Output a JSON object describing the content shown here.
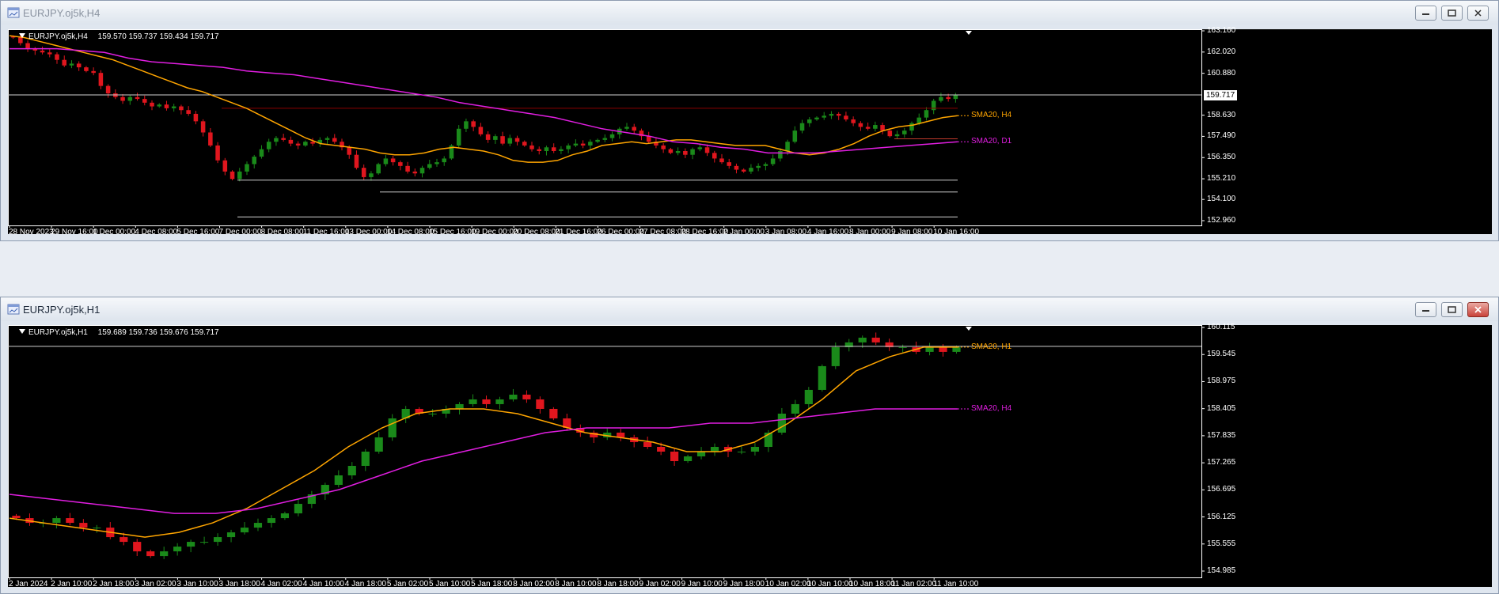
{
  "colors": {
    "bull": "#1a8a1a",
    "bear": "#e0161e",
    "sma_h4": "#ffa500",
    "sma_d1": "#e11ee1",
    "grid": "#ffffff"
  },
  "window1": {
    "title": "EURJPY.oj5k,H4",
    "symbol_tf": "EURJPY.oj5k,H4",
    "open": "159.570",
    "high": "159.737",
    "low": "159.434",
    "close": "159.717",
    "current_price": "159.717",
    "price_labels": [
      "163.160",
      "162.020",
      "160.880",
      "159.717",
      "158.630",
      "157.490",
      "156.350",
      "155.210",
      "154.100",
      "152.960"
    ],
    "time_labels": [
      "28 Nov 2023",
      "29 Nov 16:00",
      "1 Dec 00:00",
      "4 Dec 08:00",
      "5 Dec 16:00",
      "7 Dec 00:00",
      "8 Dec 08:00",
      "11 Dec 16:00",
      "13 Dec 00:00",
      "14 Dec 08:00",
      "15 Dec 16:00",
      "19 Dec 00:00",
      "20 Dec 08:00",
      "21 Dec 16:00",
      "26 Dec 00:00",
      "27 Dec 08:00",
      "28 Dec 16:00",
      "2 Jan 00:00",
      "3 Jan 08:00",
      "4 Jan 16:00",
      "8 Jan 00:00",
      "9 Jan 08:00",
      "10 Jan 16:00"
    ],
    "indicators": [
      {
        "label": "SMA20, H4",
        "color": "#ffa500"
      },
      {
        "label": "SMA20, D1",
        "color": "#e11ee1"
      }
    ]
  },
  "window2": {
    "title": "EURJPY.oj5k,H1",
    "symbol_tf": "EURJPY.oj5k,H1",
    "open": "159.689",
    "high": "159.736",
    "low": "159.676",
    "close": "159.717",
    "current_price": "159.717",
    "price_labels": [
      "160.115",
      "159.545",
      "158.975",
      "158.405",
      "157.835",
      "157.265",
      "156.695",
      "156.125",
      "155.555",
      "154.985"
    ],
    "time_labels": [
      "2 Jan 2024",
      "2 Jan 10:00",
      "2 Jan 18:00",
      "3 Jan 02:00",
      "3 Jan 10:00",
      "3 Jan 18:00",
      "4 Jan 02:00",
      "4 Jan 10:00",
      "4 Jan 18:00",
      "5 Jan 02:00",
      "5 Jan 10:00",
      "5 Jan 18:00",
      "8 Jan 02:00",
      "8 Jan 10:00",
      "8 Jan 18:00",
      "9 Jan 02:00",
      "9 Jan 10:00",
      "9 Jan 18:00",
      "10 Jan 02:00",
      "10 Jan 10:00",
      "10 Jan 18:00",
      "11 Jan 02:00",
      "11 Jan 10:00"
    ],
    "indicators": [
      {
        "label": "SMA20, H1",
        "color": "#ffa500"
      },
      {
        "label": "SMA20, H4",
        "color": "#e11ee1"
      }
    ]
  },
  "chart_data": [
    {
      "type": "candlestick",
      "title": "EURJPY.oj5k,H4",
      "ylim": [
        152.96,
        163.16
      ],
      "y_ticks": [
        163.16,
        162.02,
        160.88,
        159.717,
        158.63,
        157.49,
        156.35,
        155.21,
        154.1,
        152.96
      ],
      "closes_approx": [
        162.8,
        162.5,
        162.2,
        162.1,
        162.0,
        161.9,
        161.6,
        161.3,
        161.4,
        161.2,
        161.0,
        160.9,
        160.2,
        159.8,
        159.6,
        159.4,
        159.6,
        159.5,
        159.3,
        159.1,
        159.2,
        159.0,
        159.1,
        158.9,
        158.7,
        158.3,
        157.7,
        157.0,
        156.2,
        155.6,
        155.2,
        155.6,
        156.0,
        156.4,
        156.8,
        157.2,
        157.4,
        157.3,
        157.1,
        157.0,
        157.2,
        157.1,
        157.3,
        157.4,
        157.2,
        156.9,
        156.5,
        155.8,
        155.3,
        155.5,
        156.0,
        156.3,
        156.1,
        155.9,
        155.6,
        155.5,
        155.8,
        156.0,
        156.1,
        156.3,
        157.0,
        157.9,
        158.3,
        158.0,
        157.6,
        157.3,
        157.5,
        157.1,
        157.4,
        157.2,
        157.0,
        156.8,
        156.7,
        156.9,
        156.7,
        156.8,
        157.0,
        157.1,
        157.0,
        157.2,
        157.3,
        157.4,
        157.6,
        157.9,
        158.0,
        157.8,
        157.5,
        157.2,
        157.0,
        156.8,
        156.6,
        156.7,
        156.5,
        156.8,
        156.9,
        156.6,
        156.3,
        156.1,
        155.9,
        155.7,
        155.6,
        155.8,
        155.9,
        156.0,
        156.3,
        156.7,
        157.2,
        157.8,
        158.2,
        158.4,
        158.5,
        158.6,
        158.7,
        158.6,
        158.4,
        158.2,
        158.0,
        157.9,
        158.1,
        157.8,
        157.5,
        157.6,
        157.8,
        158.2,
        158.5,
        158.9,
        159.4,
        159.6,
        159.5,
        159.7
      ],
      "series": [
        {
          "name": "SMA20, H4",
          "values": [
            162.9,
            162.8,
            162.6,
            162.4,
            162.2,
            162.0,
            161.8,
            161.6,
            161.3,
            161.0,
            160.7,
            160.4,
            160.1,
            159.9,
            159.6,
            159.3,
            159.0,
            158.6,
            158.2,
            157.8,
            157.4,
            157.1,
            157.0,
            156.9,
            156.8,
            156.6,
            156.5,
            156.5,
            156.6,
            156.8,
            156.9,
            156.8,
            156.7,
            156.5,
            156.2,
            156.1,
            156.1,
            156.2,
            156.5,
            156.7,
            157.0,
            157.1,
            157.2,
            157.1,
            157.2,
            157.3,
            157.3,
            157.2,
            157.1,
            157.0,
            157.0,
            157.0,
            156.8,
            156.6,
            156.5,
            156.6,
            156.8,
            157.1,
            157.5,
            157.8,
            158.0,
            158.1,
            158.3,
            158.5,
            158.6
          ]
        },
        {
          "name": "SMA20, D1",
          "values": [
            162.2,
            162.2,
            162.2,
            162.1,
            162.0,
            161.7,
            161.5,
            161.4,
            161.3,
            161.2,
            161.0,
            160.9,
            160.8,
            160.6,
            160.4,
            160.2,
            160.0,
            159.8,
            159.6,
            159.3,
            159.1,
            158.9,
            158.7,
            158.5,
            158.2,
            157.9,
            157.7,
            157.5,
            157.2,
            157.1,
            156.9,
            156.8,
            156.6,
            156.6,
            156.6,
            156.7,
            156.8,
            156.9,
            157.0,
            157.1,
            157.2
          ]
        }
      ],
      "levels": [
        159.717,
        159.0,
        157.36,
        155.14,
        154.5,
        153.16
      ]
    },
    {
      "type": "candlestick",
      "title": "EURJPY.oj5k,H1",
      "ylim": [
        154.985,
        160.115
      ],
      "y_ticks": [
        160.115,
        159.717,
        159.545,
        158.975,
        158.405,
        157.835,
        157.265,
        156.695,
        156.125,
        155.555,
        154.985
      ],
      "closes_approx": [
        156.1,
        156.0,
        156.0,
        156.1,
        156.0,
        155.9,
        155.9,
        155.7,
        155.6,
        155.4,
        155.3,
        155.4,
        155.5,
        155.6,
        155.6,
        155.7,
        155.8,
        155.9,
        156.0,
        156.1,
        156.2,
        156.4,
        156.6,
        156.8,
        157.0,
        157.2,
        157.5,
        157.8,
        158.2,
        158.4,
        158.3,
        158.3,
        158.4,
        158.5,
        158.6,
        158.5,
        158.6,
        158.7,
        158.6,
        158.4,
        158.2,
        158.0,
        157.9,
        157.8,
        157.9,
        157.8,
        157.7,
        157.6,
        157.5,
        157.3,
        157.4,
        157.5,
        157.6,
        157.5,
        157.5,
        157.6,
        157.9,
        158.3,
        158.5,
        158.8,
        159.3,
        159.7,
        159.8,
        159.9,
        159.8,
        159.7,
        159.7,
        159.6,
        159.7,
        159.6,
        159.7
      ],
      "series": [
        {
          "name": "SMA20, H1",
          "values": [
            156.1,
            156.0,
            155.9,
            155.8,
            155.7,
            155.8,
            156.0,
            156.3,
            156.7,
            157.1,
            157.6,
            158.0,
            158.3,
            158.4,
            158.4,
            158.3,
            158.1,
            157.9,
            157.8,
            157.7,
            157.5,
            157.5,
            157.7,
            158.1,
            158.6,
            159.2,
            159.5,
            159.7,
            159.7
          ]
        },
        {
          "name": "SMA20, H4",
          "values": [
            156.6,
            156.5,
            156.4,
            156.3,
            156.2,
            156.2,
            156.3,
            156.5,
            156.7,
            157.0,
            157.3,
            157.5,
            157.7,
            157.9,
            158.0,
            158.0,
            158.0,
            158.1,
            158.1,
            158.2,
            158.3,
            158.4,
            158.4,
            158.4
          ]
        }
      ],
      "levels": [
        159.717
      ]
    }
  ]
}
